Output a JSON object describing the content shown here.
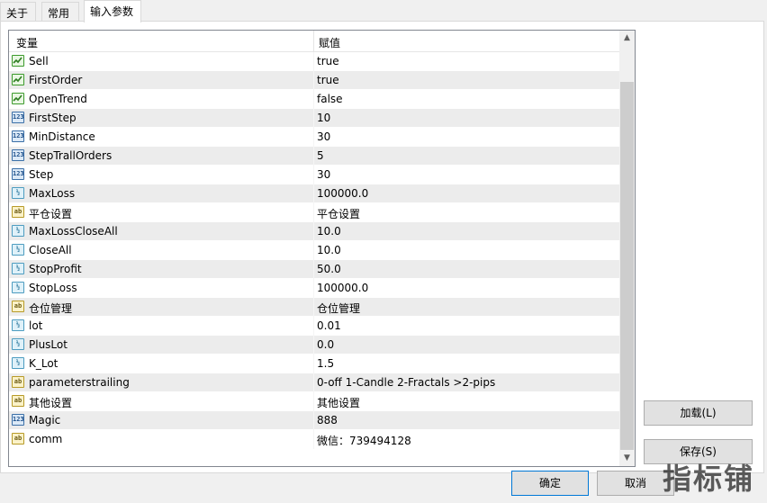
{
  "tabs": [
    {
      "label": "关于"
    },
    {
      "label": "常用"
    },
    {
      "label": "输入参数"
    }
  ],
  "grid": {
    "col_name": "变量",
    "col_value": "赋值",
    "rows": [
      {
        "icon": "bool",
        "name": "Sell",
        "value": "true"
      },
      {
        "icon": "bool",
        "name": "FirstOrder",
        "value": "true"
      },
      {
        "icon": "bool",
        "name": "OpenTrend",
        "value": "false"
      },
      {
        "icon": "int",
        "name": "FirstStep",
        "value": "10"
      },
      {
        "icon": "int",
        "name": "MinDistance",
        "value": "30"
      },
      {
        "icon": "int",
        "name": "StepTrallOrders",
        "value": "5"
      },
      {
        "icon": "int",
        "name": "Step",
        "value": "30"
      },
      {
        "icon": "dbl",
        "name": "MaxLoss",
        "value": "100000.0"
      },
      {
        "icon": "str",
        "name": "平仓设置",
        "value": "平仓设置"
      },
      {
        "icon": "dbl",
        "name": "MaxLossCloseAll",
        "value": "10.0"
      },
      {
        "icon": "dbl",
        "name": "CloseAll",
        "value": "10.0"
      },
      {
        "icon": "dbl",
        "name": "StopProfit",
        "value": "50.0"
      },
      {
        "icon": "dbl",
        "name": "StopLoss",
        "value": "100000.0"
      },
      {
        "icon": "str",
        "name": "仓位管理",
        "value": "仓位管理"
      },
      {
        "icon": "dbl",
        "name": "lot",
        "value": "0.01"
      },
      {
        "icon": "dbl",
        "name": "PlusLot",
        "value": "0.0"
      },
      {
        "icon": "dbl",
        "name": "K_Lot",
        "value": "1.5"
      },
      {
        "icon": "str",
        "name": "parameterstrailing",
        "value": "0-off  1-Candle  2-Fractals  >2-pips"
      },
      {
        "icon": "str",
        "name": "其他设置",
        "value": "其他设置"
      },
      {
        "icon": "int",
        "name": "Magic",
        "value": "888"
      },
      {
        "icon": "str",
        "name": "comm",
        "value": "微信：739494128"
      }
    ]
  },
  "icons": {
    "bool": "bool-icon",
    "int": "123",
    "dbl": "½",
    "str": "ab"
  },
  "buttons": {
    "load": "加载(L)",
    "save": "保存(S)",
    "ok": "确定",
    "cancel": "取消"
  },
  "watermark": "指标铺"
}
